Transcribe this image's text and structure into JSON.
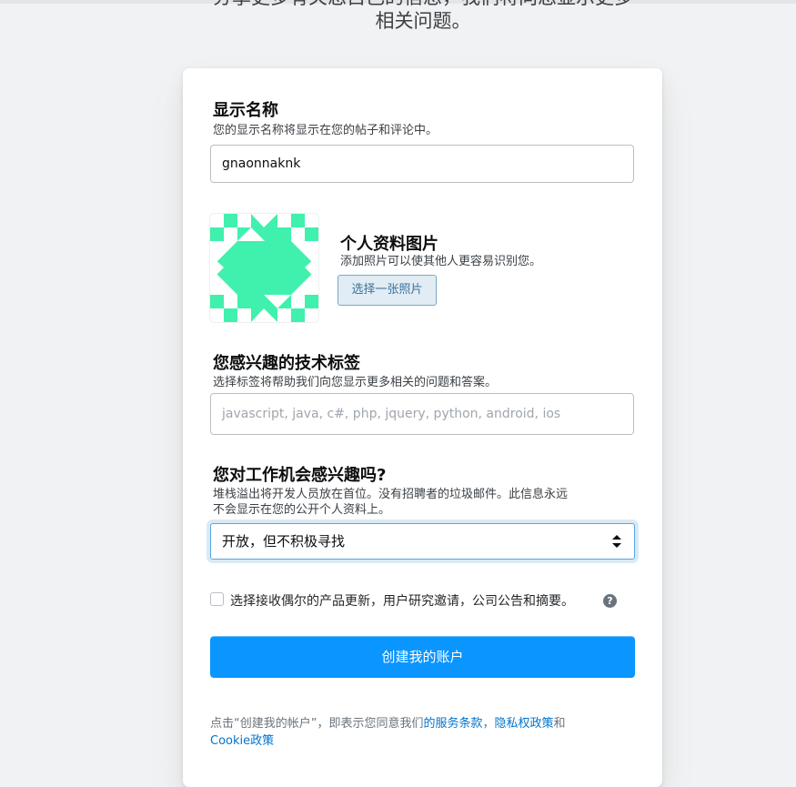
{
  "intro": {
    "line1": "分享更多有关您自己的信息，我们将向您显示更多",
    "line2": "相关问题。"
  },
  "display_name": {
    "title": "显示名称",
    "description": "您的显示名称将显示在您的帖子和评论中。",
    "value": "gnaonnaknk"
  },
  "profile_picture": {
    "title": "个人资料图片",
    "description": "添加照片可以使其他人更容易识别您。",
    "button_label": "选择一张照片",
    "avatar_color": "#40f0ad"
  },
  "tech_tags": {
    "title": "您感兴趣的技术标签",
    "description": "选择标签将帮助我们向您显示更多相关的问题和答案。",
    "placeholder": "javascript, java, c#, php, jquery, python, android, ios"
  },
  "job_interest": {
    "title": "您对工作机会感兴趣吗?",
    "description_line1": "堆栈溢出将开发人员放在首位。没有招聘者的垃圾邮件。此信息永远",
    "description_line2": "不会显示在您的公开个人资料上。",
    "selected_option": "开放，但不积极寻找"
  },
  "opt_in": {
    "label": "选择接收偶尔的产品更新，用户研究邀请，公司公告和摘要。",
    "checked": false,
    "help_icon": "question-circle-icon"
  },
  "submit": {
    "label": "创建我的账户",
    "color": "#0a95ff"
  },
  "legal": {
    "prefix": "点击“创建我的帐户”，即表示您同意我们",
    "terms_link": "的服务条款",
    "separator": "，",
    "privacy_link": "隐私权政策",
    "and": "和",
    "cookie_link": "Cookie政策"
  }
}
